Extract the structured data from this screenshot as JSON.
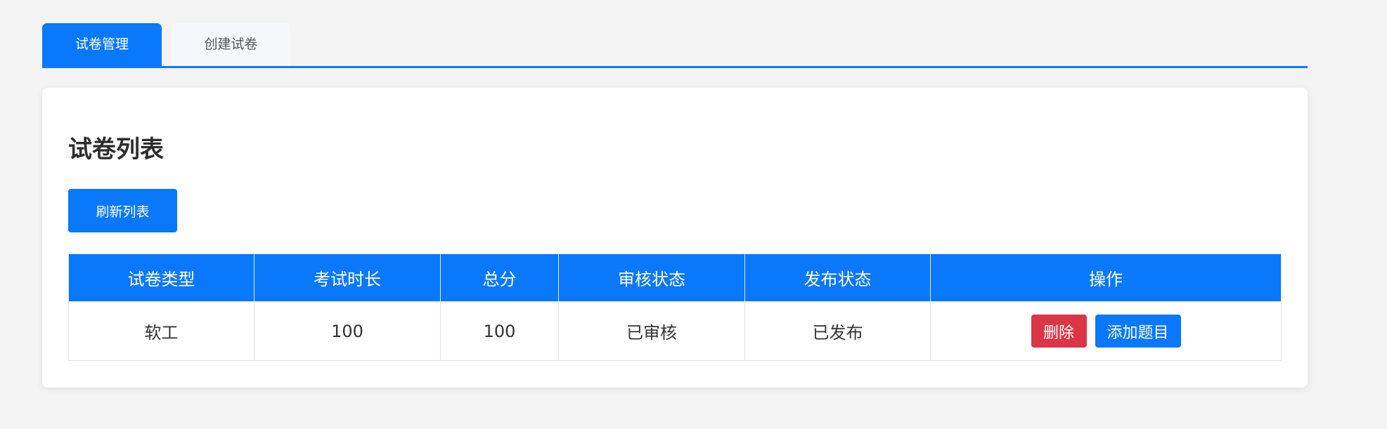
{
  "tabs": {
    "manage": "试卷管理",
    "create": "创建试卷",
    "active_color": "#0a78fb"
  },
  "main": {
    "title": "试卷列表",
    "refresh_label": "刷新列表"
  },
  "table": {
    "headers": [
      "试卷类型",
      "考试时长",
      "总分",
      "审核状态",
      "发布状态",
      "操作"
    ],
    "rows": [
      {
        "type": "软工",
        "duration": "100",
        "score": "100",
        "review_status": "已审核",
        "publish_status": "已发布",
        "delete_label": "删除",
        "add_question_label": "添加题目"
      }
    ]
  },
  "colors": {
    "primary": "#0a78fb",
    "danger": "#dc3545",
    "background": "#f3f3f3"
  }
}
